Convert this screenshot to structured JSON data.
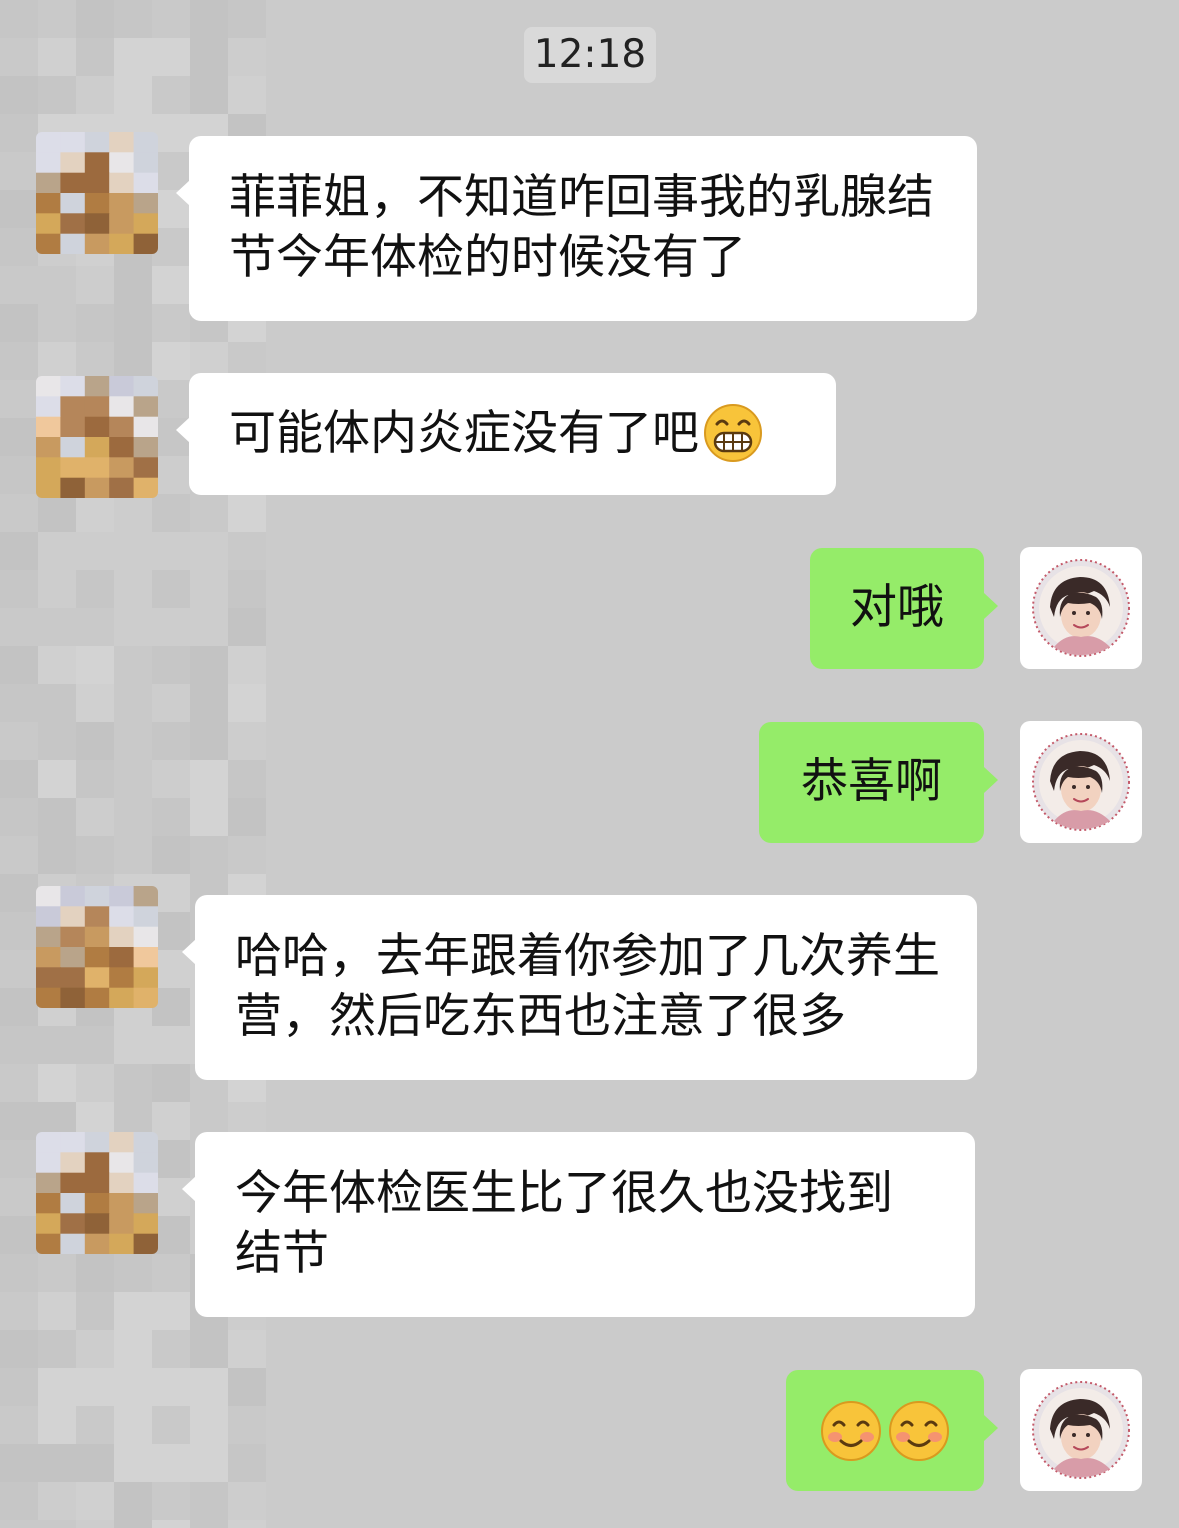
{
  "timestamp": "12:18",
  "messages": [
    {
      "side": "left",
      "text": "菲菲姐，不知道咋回事我的乳腺结节今年体检的时候没有了"
    },
    {
      "side": "left",
      "text": "可能体内炎症没有了吧",
      "emoji": "grinning-face"
    },
    {
      "side": "right",
      "text": "对哦"
    },
    {
      "side": "right",
      "text": "恭喜啊"
    },
    {
      "side": "left",
      "text": "哈哈，去年跟着你参加了几次养生营，然后吃东西也注意了很多"
    },
    {
      "side": "left",
      "text": "今年体检医生比了很久也没找到结节"
    },
    {
      "side": "right",
      "emoji": [
        "smiling-face-with-smiling-eyes",
        "smiling-face-with-smiling-eyes"
      ]
    }
  ],
  "colors": {
    "background": "#cbcbcb",
    "received_bubble": "#ffffff",
    "sent_bubble": "#95ec69",
    "timestamp_bg": "#d9d9d9"
  }
}
